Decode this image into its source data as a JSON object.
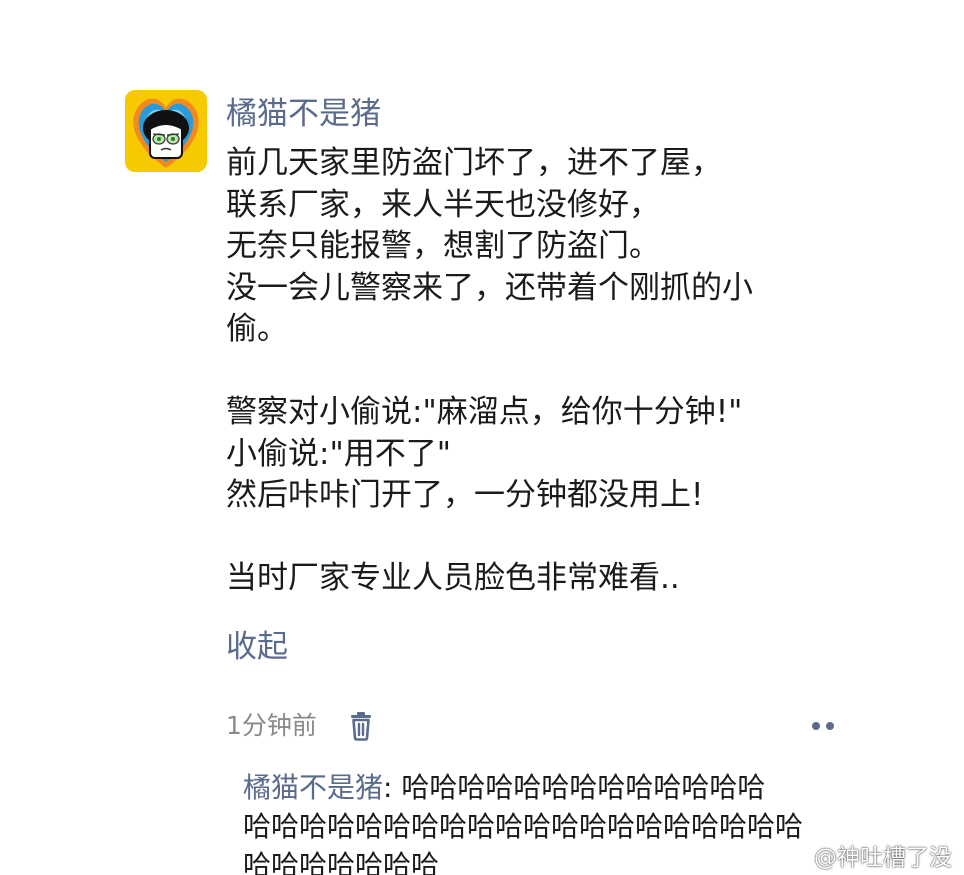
{
  "comment": {
    "username": "橘猫不是猪",
    "body_lines": [
      "前几天家里防盗门坏了，进不了屋，",
      "联系厂家，来人半天也没修好，",
      "无奈只能报警，想割了防盗门。",
      "没一会儿警察来了，还带着个刚抓的小",
      "偷。",
      "",
      "警察对小偷说:\"麻溜点，给你十分钟!\"",
      "小偷说:\"用不了\"",
      "然后咔咔门开了，一分钟都没用上!",
      "",
      "当时厂家专业人员脸色非常难看.."
    ],
    "collapse_label": "收起",
    "timestamp": "1分钟前",
    "icons": {
      "delete": "trash-icon",
      "more": "more-dots-icon",
      "avatar": "cartoon-girl-avatar"
    }
  },
  "reply": {
    "author": "橘猫不是猪",
    "separator": ": ",
    "lines": [
      "哈哈哈哈哈哈哈哈哈哈哈哈哈",
      "哈哈哈哈哈哈哈哈哈哈哈哈哈哈哈哈哈哈哈哈",
      "哈哈哈哈哈哈哈"
    ]
  },
  "watermark": {
    "text": "@神吐槽了没",
    "icon": "weibo-logo-icon"
  },
  "colors": {
    "link": "#5a6b8c",
    "body_text": "#1b1b1b",
    "meta_text": "#8a8a8a",
    "icon": "#5a6b8c"
  }
}
